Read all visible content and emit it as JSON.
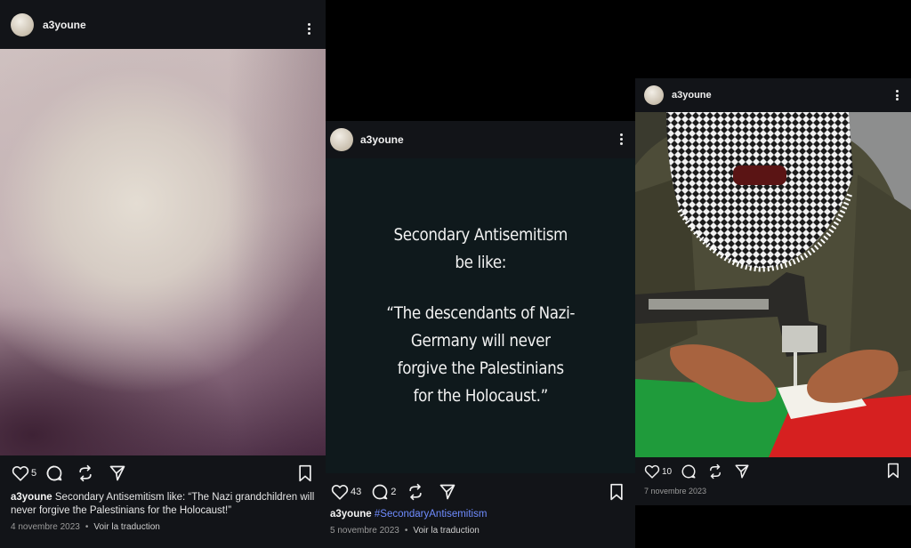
{
  "posts": [
    {
      "username": "a3youne",
      "likes": "5",
      "caption_user": "a3youne",
      "caption_text": "Secondary Antisemitism like: “The Nazi grandchildren will never forgive the Palestinians for the Holocaust!”",
      "date": "4 novembre 2023",
      "translate": "Voir la traduction"
    },
    {
      "username": "a3youne",
      "likes": "43",
      "comments": "2",
      "card_title_1": "Secondary Antisemitism",
      "card_title_2": "be like:",
      "card_quote_1": "“The descendants of Nazi-",
      "card_quote_2": "Germany will never",
      "card_quote_3": "forgive the Palestinians",
      "card_quote_4": "for the Holocaust.”",
      "caption_user": "a3youne",
      "caption_hashtag": "#SecondaryAntisemitism",
      "date": "5 novembre 2023",
      "translate": "Voir la traduction"
    },
    {
      "username": "a3youne",
      "likes": "10",
      "date": "7 novembre 2023"
    }
  ],
  "icons": {
    "like": "heart-icon",
    "comment": "comment-icon",
    "repost": "repost-icon",
    "share": "send-icon",
    "save": "bookmark-icon",
    "more": "more-options-icon"
  },
  "colors": {
    "background": "#000000",
    "panel": "#121418",
    "hashtag": "#6f8cff",
    "muted": "#9a9a9a"
  }
}
